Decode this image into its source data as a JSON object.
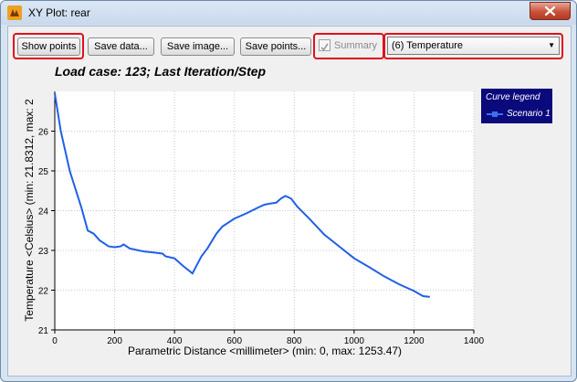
{
  "window": {
    "title": "XY Plot: rear"
  },
  "toolbar": {
    "show_points": "Show points",
    "save_data": "Save data...",
    "save_image": "Save image...",
    "save_points": "Save points...",
    "summary": "Summary",
    "summary_checked": true,
    "variable_select": "(6) Temperature"
  },
  "icons": {
    "app": "app-logo-icon",
    "close": "close-icon",
    "dropdown": "chevron-down-icon"
  },
  "chart_data": {
    "type": "line",
    "title": "Load case: 123; Last Iteration/Step",
    "xlabel": "Parametric Distance <millimeter> (min: 0, max: 1253.47)",
    "ylabel": "Temperature <Celsius> (min: 21.8312, max: 2",
    "xlim": [
      0,
      1400
    ],
    "ylim": [
      21,
      27
    ],
    "xticks": [
      "0",
      "200",
      "400",
      "600",
      "800",
      "1000",
      "1200",
      "1400"
    ],
    "yticks": [
      "21",
      "22",
      "23",
      "24",
      "25",
      "26"
    ],
    "grid": true,
    "legend_title": "Curve legend",
    "legend_position": "top-right",
    "series": [
      {
        "name": "Scenario 1",
        "color": "#1f5fe8",
        "x": [
          0,
          20,
          50,
          90,
          110,
          130,
          150,
          180,
          200,
          220,
          230,
          250,
          280,
          300,
          330,
          360,
          370,
          400,
          430,
          460,
          490,
          510,
          540,
          560,
          600,
          640,
          680,
          700,
          720,
          740,
          755,
          770,
          790,
          810,
          850,
          900,
          950,
          1000,
          1050,
          1100,
          1150,
          1200,
          1230,
          1253
        ],
        "y": [
          26.95,
          26.0,
          25.0,
          24.05,
          23.5,
          23.42,
          23.25,
          23.1,
          23.08,
          23.1,
          23.15,
          23.05,
          23.0,
          22.97,
          22.95,
          22.92,
          22.85,
          22.8,
          22.6,
          22.42,
          22.85,
          23.05,
          23.42,
          23.6,
          23.8,
          23.93,
          24.08,
          24.15,
          24.18,
          24.2,
          24.3,
          24.37,
          24.3,
          24.1,
          23.8,
          23.4,
          23.1,
          22.8,
          22.58,
          22.35,
          22.15,
          21.98,
          21.85,
          21.83
        ]
      }
    ]
  }
}
